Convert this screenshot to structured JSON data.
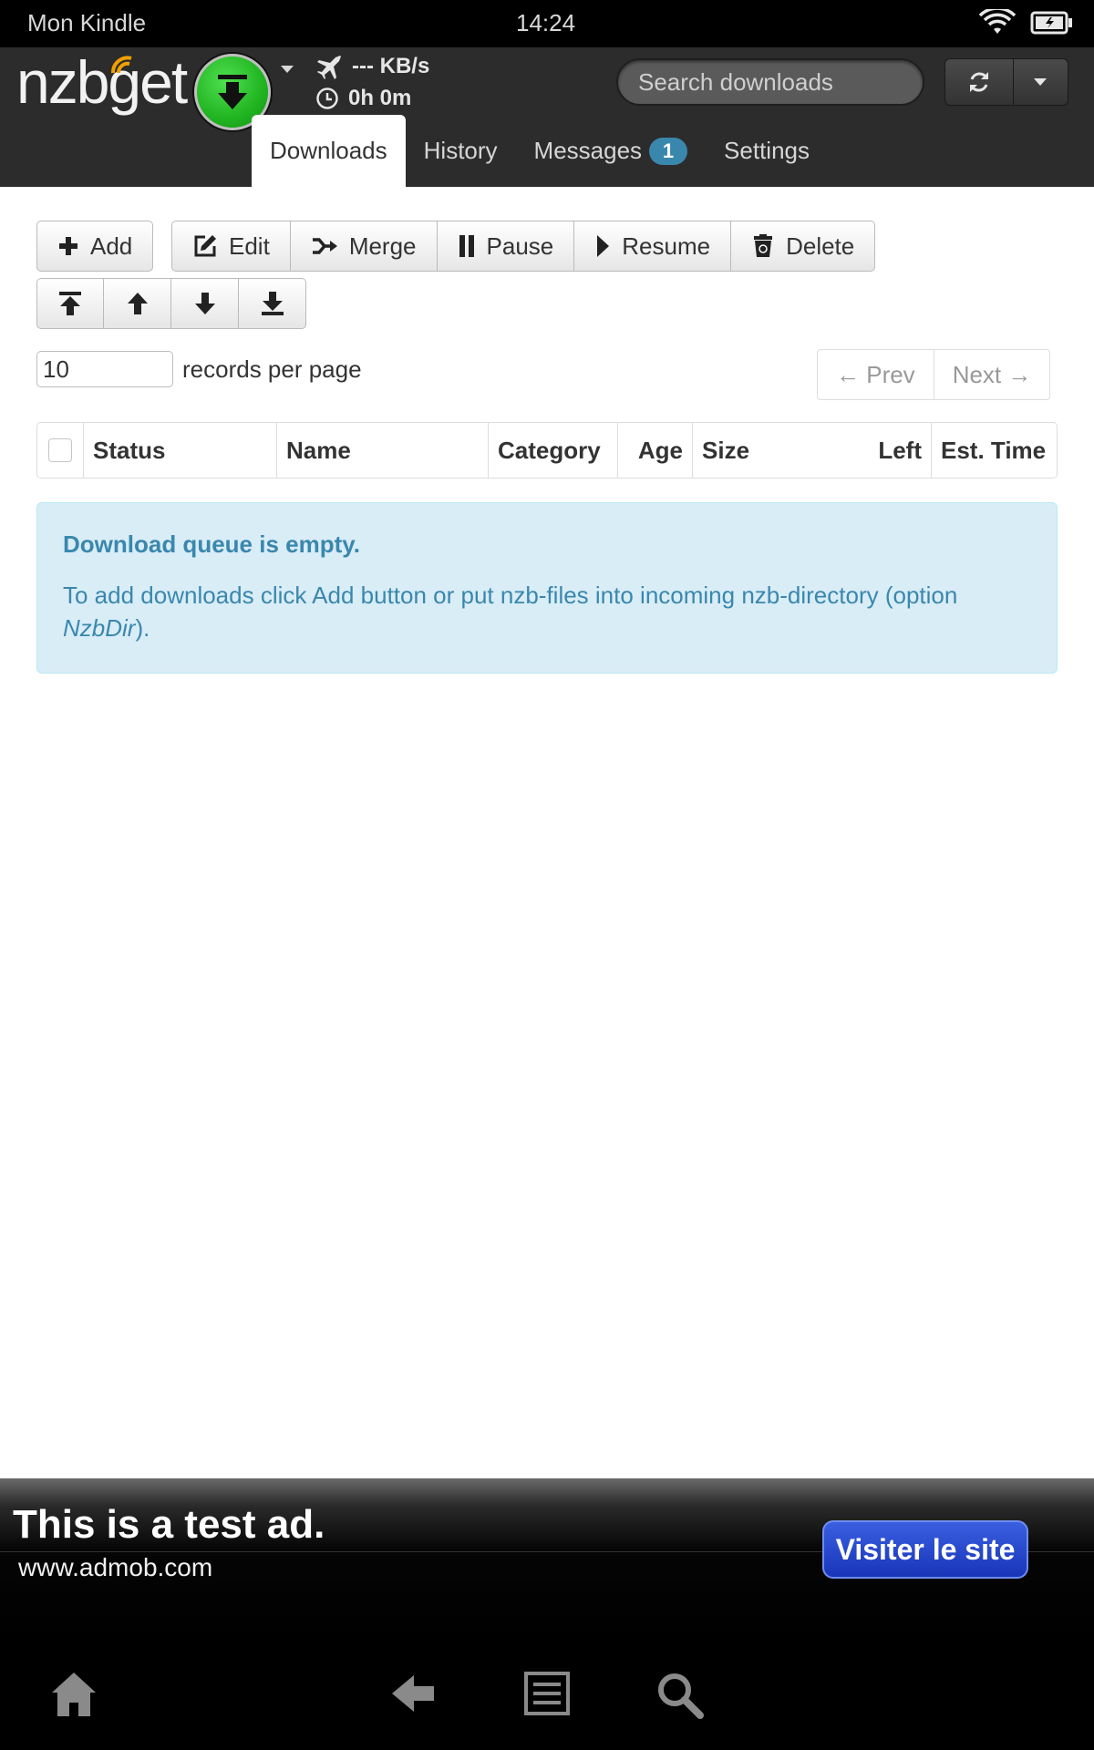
{
  "statusbar": {
    "device_name": "Mon Kindle",
    "clock": "14:24"
  },
  "header": {
    "logo": "nzbget",
    "speed": "--- KB/s",
    "time_left": "0h 0m",
    "search_placeholder": "Search downloads"
  },
  "tabs": [
    {
      "label": "Downloads",
      "active": true
    },
    {
      "label": "History"
    },
    {
      "label": "Messages",
      "badge": "1"
    },
    {
      "label": "Settings"
    }
  ],
  "toolbar": {
    "add": "Add",
    "edit": "Edit",
    "merge": "Merge",
    "pause": "Pause",
    "resume": "Resume",
    "delete": "Delete"
  },
  "paging": {
    "records_per_page": "10",
    "records_label": "records per page",
    "prev": "← Prev",
    "next": "Next →"
  },
  "table": {
    "columns": [
      "Status",
      "Name",
      "Category",
      "Age",
      "Size",
      "Left",
      "Est. Time"
    ]
  },
  "alert": {
    "title": "Download queue is empty.",
    "body_before": "To add downloads click Add button or put nzb-files into incoming nzb-directory (option ",
    "body_option": "NzbDir",
    "body_after": ")."
  },
  "ad": {
    "headline": "This is a test ad.",
    "url": "www.admob.com",
    "cta": "Visiter le site"
  },
  "colors": {
    "header_bg": "#2c2c2c",
    "alert_bg": "#d9edf7",
    "alert_text": "#3a87ad",
    "badge": "#3a87ad",
    "play_green": "#21b421",
    "ad_button": "#1835b8"
  }
}
